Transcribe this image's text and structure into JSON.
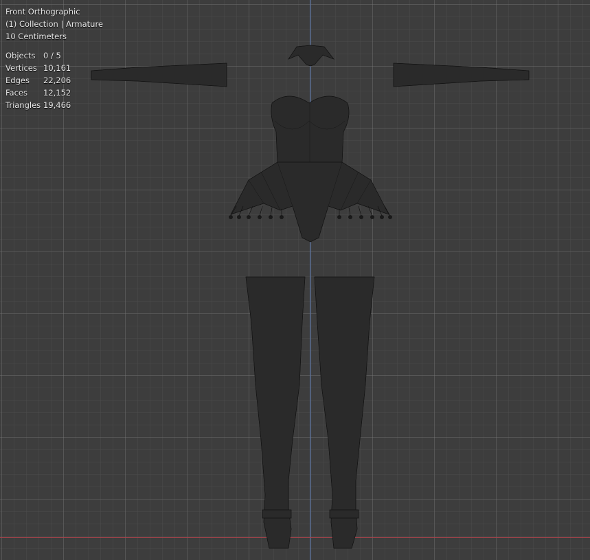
{
  "viewport": {
    "view_name": "Front Orthographic",
    "collection_info": "(1) Collection | Armature",
    "scale_info": "10 Centimeters",
    "stats": [
      {
        "label": "Objects",
        "value": "0 / 5"
      },
      {
        "label": "Vertices",
        "value": "10,161"
      },
      {
        "label": "Edges",
        "value": "22,206"
      },
      {
        "label": "Faces",
        "value": "12,152"
      },
      {
        "label": "Triangles",
        "value": "19,466"
      }
    ]
  },
  "colors": {
    "background": "#3d3d3d",
    "y_axis": "#4e6fb0",
    "x_axis": "#a8434b",
    "text": "#e6e6e6"
  }
}
